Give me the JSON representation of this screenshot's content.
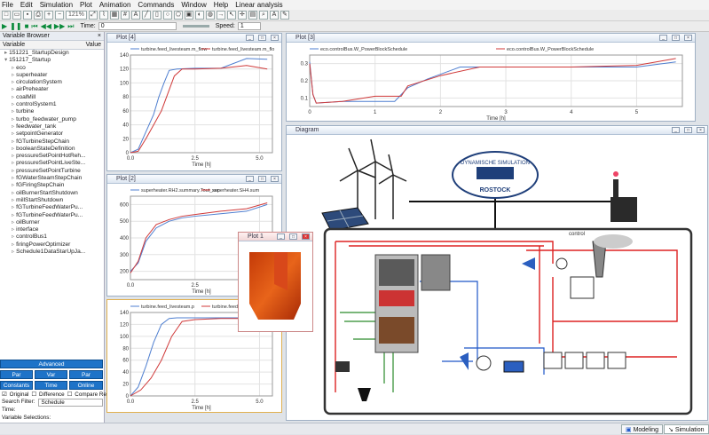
{
  "menu": [
    "File",
    "Edit",
    "Simulation",
    "Plot",
    "Animation",
    "Commands",
    "Window",
    "Help",
    "Linear analysis"
  ],
  "toolbar": {
    "zoom": "121%",
    "time_label": "Time:",
    "time_value": "0",
    "speed_label": "Speed:",
    "speed_value": "1"
  },
  "variable_browser": {
    "title": "Variable Browser",
    "col_variable": "Variable",
    "col_value": "Value",
    "items": [
      {
        "label": "151221_StartupDesign",
        "level": 1
      },
      {
        "label": "151217_Startup",
        "level": 1
      },
      {
        "label": "eco",
        "level": 2
      },
      {
        "label": "superheater",
        "level": 2
      },
      {
        "label": "circulationSystem",
        "level": 2
      },
      {
        "label": "airPreheater",
        "level": 2
      },
      {
        "label": "coalMill",
        "level": 2
      },
      {
        "label": "controlSystem1",
        "level": 2
      },
      {
        "label": "turbine",
        "level": 2
      },
      {
        "label": "turbo_feedwater_pump",
        "level": 2
      },
      {
        "label": "feedwater_tank",
        "level": 2
      },
      {
        "label": "setpointGenerator",
        "level": 2
      },
      {
        "label": "fGTurbineStepChain",
        "level": 2
      },
      {
        "label": "booleanStateDefinition",
        "level": 2
      },
      {
        "label": "pressureSetPointHotReh...",
        "level": 2
      },
      {
        "label": "pressureSetPointLiveSte...",
        "level": 2
      },
      {
        "label": "pressureSetPointTurbine",
        "level": 2
      },
      {
        "label": "fGWaterSteamStepChain",
        "level": 2
      },
      {
        "label": "fGFiringStepChain",
        "level": 2
      },
      {
        "label": "oilBurnerStartShutdown",
        "level": 2
      },
      {
        "label": "millStartShutdown",
        "level": 2
      },
      {
        "label": "fGTurbineFeedWaterPu...",
        "level": 2
      },
      {
        "label": "fGTurbineFeedWaterPu...",
        "level": 2
      },
      {
        "label": "oilBurner",
        "level": 2
      },
      {
        "label": "interface",
        "level": 2
      },
      {
        "label": "controlBus1",
        "level": 2
      },
      {
        "label": "firingPowerOptimizer",
        "level": 2
      },
      {
        "label": "Schedule1DataStarUpJa...",
        "level": 2
      }
    ],
    "advanced_label": "Advanced",
    "constants_label": "Constants",
    "time_varying_label": "Time varying",
    "online_label": "Online",
    "original_label": "Original",
    "difference_label": "Difference",
    "compare_label": "Compare Results",
    "search_filter_label": "Search Filter:",
    "search_filter_value": "Schedule",
    "time_label": "Time:",
    "selections_label": "Variable Selections:"
  },
  "plot4": {
    "title": "Plot [4]",
    "legend": [
      "turbine.feed_livesteam.m_flow",
      "turbine.feed_livesteam.m_flo"
    ],
    "yticks": [
      "0",
      "20",
      "40",
      "60",
      "80",
      "100",
      "120",
      "140"
    ],
    "xticks": [
      "0.0",
      "2.5",
      "5.0"
    ],
    "xlabel": "Time [h]"
  },
  "plot3": {
    "title": "Plot [3]",
    "legend": [
      "eco.controlBus.W_PowerBlockSchedule",
      "eco.controlBus.W_PowerBlockSchedule"
    ],
    "yticks": [
      "0.1",
      "0.2",
      "0.3"
    ],
    "xticks": [
      "0",
      "1",
      "2",
      "3",
      "4",
      "5"
    ],
    "xlabel": "Time [h]"
  },
  "plot2": {
    "title": "Plot [2]",
    "legend": [
      "superheater.RH2.summary.Tout_sec",
      "superheater.SH4.sum"
    ],
    "yticks": [
      "200",
      "300",
      "400",
      "500",
      "600"
    ],
    "xticks": [
      "0.0",
      "2.5",
      "5.0"
    ],
    "xlabel": "Time [h]"
  },
  "plot1": {
    "title": "Plot 1"
  },
  "plot_bottom": {
    "legend": [
      "turbine.feed_livesteam.p",
      "turbine.feed_livesteam.p"
    ],
    "yticks": [
      "0",
      "20",
      "40",
      "60",
      "80",
      "100",
      "120",
      "140"
    ],
    "xticks": [
      "0.0",
      "2.5",
      "5.0"
    ],
    "xlabel": "Time [h]"
  },
  "diagram": {
    "title": "Diagram",
    "logo_text": "DYNAMISCHE SIMULATION",
    "logo_city": "ROSTOCK",
    "control_label": "control"
  },
  "chart_data": [
    {
      "type": "line",
      "title": "Plot [4]",
      "xlabel": "Time [h]",
      "ylim": [
        0,
        140
      ],
      "xlim": [
        0,
        5.5
      ],
      "series": [
        {
          "name": "turbine.feed_livesteam.m_flow",
          "color": "#4f7fd0",
          "x": [
            0,
            0.3,
            0.6,
            0.9,
            1.1,
            1.3,
            1.5,
            1.8,
            2.5,
            3.5,
            4.5,
            5.3
          ],
          "y": [
            0,
            5,
            30,
            55,
            80,
            100,
            118,
            120,
            121,
            121,
            135,
            134
          ]
        },
        {
          "name": "turbine.feed_livesteam.m_flo",
          "color": "#d03a3a",
          "x": [
            0,
            0.3,
            0.6,
            0.9,
            1.2,
            1.5,
            1.7,
            2.0,
            2.5,
            3.5,
            4.5,
            5.3
          ],
          "y": [
            0,
            2,
            20,
            40,
            60,
            90,
            110,
            120,
            120,
            121,
            125,
            120
          ]
        }
      ]
    },
    {
      "type": "line",
      "title": "Plot [3]",
      "xlabel": "Time [h]",
      "ylim": [
        0.05,
        0.35
      ],
      "xlim": [
        0,
        5.7
      ],
      "series": [
        {
          "name": "eco.controlBus.W_PowerBlockSchedule",
          "color": "#4f7fd0",
          "x": [
            0,
            0.05,
            0.1,
            0.5,
            0.9,
            1.3,
            1.5,
            1.8,
            2.3,
            3.0,
            4.0,
            5.0,
            5.6
          ],
          "y": [
            0.31,
            0.12,
            0.07,
            0.08,
            0.08,
            0.08,
            0.16,
            0.21,
            0.28,
            0.28,
            0.28,
            0.28,
            0.31
          ]
        },
        {
          "name": "eco.controlBus.W_PowerBlockSchedule",
          "color": "#d03a3a",
          "x": [
            0,
            0.05,
            0.1,
            0.5,
            1.0,
            1.4,
            1.5,
            2.0,
            2.6,
            3.2,
            4.0,
            5.0,
            5.6
          ],
          "y": [
            0.3,
            0.12,
            0.07,
            0.08,
            0.11,
            0.11,
            0.17,
            0.23,
            0.28,
            0.28,
            0.28,
            0.29,
            0.33
          ]
        }
      ]
    },
    {
      "type": "line",
      "title": "Plot [2]",
      "xlabel": "Time [h]",
      "ylim": [
        150,
        650
      ],
      "xlim": [
        0,
        5.5
      ],
      "series": [
        {
          "name": "superheater.RH2.summary.Tout_sec",
          "color": "#4f7fd0",
          "x": [
            0,
            0.3,
            0.6,
            1.0,
            1.5,
            2.0,
            2.5,
            3.5,
            4.5,
            5.3
          ],
          "y": [
            200,
            250,
            380,
            460,
            500,
            520,
            530,
            545,
            560,
            600
          ]
        },
        {
          "name": "superheater.SH4.sum",
          "color": "#d03a3a",
          "x": [
            0,
            0.3,
            0.6,
            1.0,
            1.5,
            2.0,
            2.5,
            3.5,
            4.5,
            5.3
          ],
          "y": [
            190,
            260,
            400,
            480,
            510,
            530,
            540,
            560,
            575,
            610
          ]
        }
      ]
    },
    {
      "type": "line",
      "title": "",
      "xlabel": "Time [h]",
      "ylim": [
        0,
        140
      ],
      "xlim": [
        0,
        5.5
      ],
      "series": [
        {
          "name": "turbine.feed_livesteam.p",
          "color": "#4f7fd0",
          "x": [
            0,
            0.3,
            0.6,
            0.9,
            1.2,
            1.5,
            1.8,
            2.5,
            3.5,
            4.5,
            5.3
          ],
          "y": [
            0,
            15,
            50,
            90,
            120,
            130,
            131,
            131,
            131,
            131,
            131
          ]
        },
        {
          "name": "turbine.feed_livesteam.p",
          "color": "#d03a3a",
          "x": [
            0,
            0.4,
            0.8,
            1.2,
            1.6,
            2.0,
            2.5,
            3.5,
            4.5,
            5.3
          ],
          "y": [
            0,
            10,
            30,
            60,
            100,
            125,
            128,
            130,
            130,
            130
          ]
        }
      ]
    }
  ],
  "status": {
    "modeling_label": "Modeling",
    "simulation_label": "Simulation"
  }
}
